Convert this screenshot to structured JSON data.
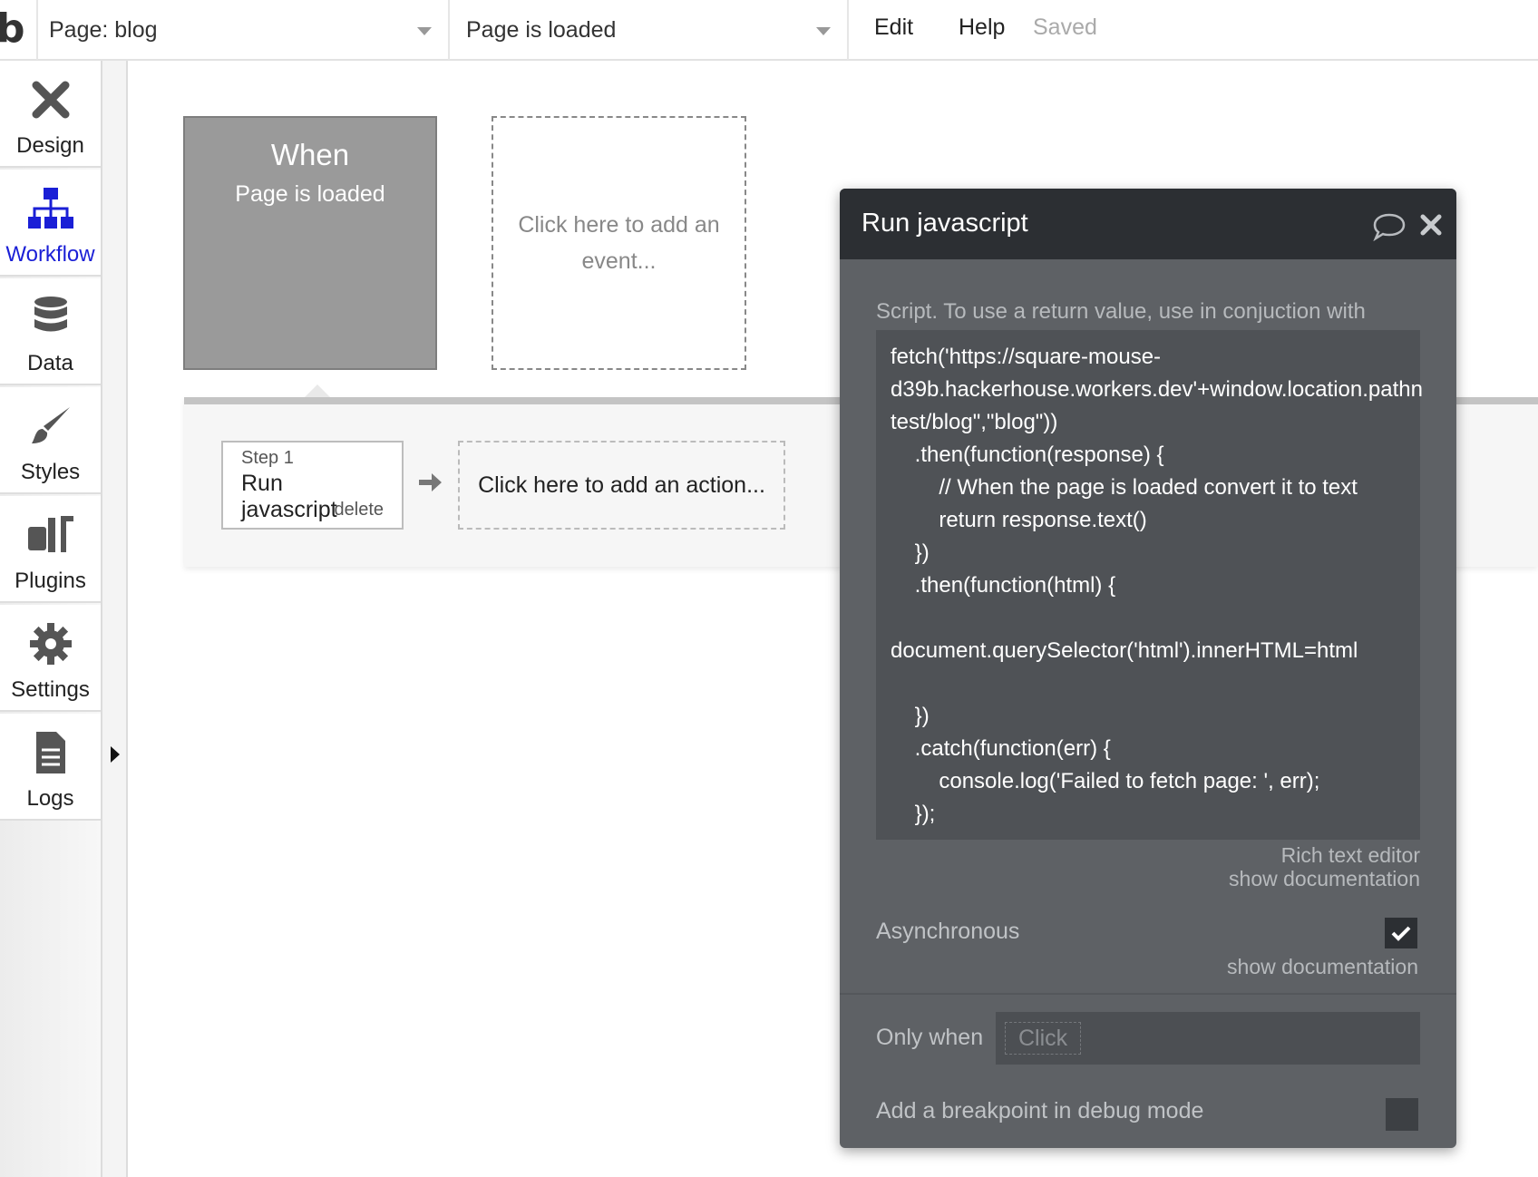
{
  "topbar": {
    "logo": "b",
    "page_select": "Page: blog",
    "event_select": "Page is loaded",
    "menu": [
      "Edit",
      "Help"
    ],
    "status": "Saved"
  },
  "sidebar": {
    "items": [
      {
        "label": "Design",
        "icon": "design-icon"
      },
      {
        "label": "Workflow",
        "icon": "workflow-icon",
        "active": true
      },
      {
        "label": "Data",
        "icon": "database-icon"
      },
      {
        "label": "Styles",
        "icon": "brush-icon"
      },
      {
        "label": "Plugins",
        "icon": "plugins-icon"
      },
      {
        "label": "Settings",
        "icon": "gear-icon"
      },
      {
        "label": "Logs",
        "icon": "document-icon"
      }
    ]
  },
  "canvas": {
    "event_card": {
      "title": "When",
      "subtitle": "Page is loaded"
    },
    "add_event": "Click here to add an event...",
    "step": {
      "number": "Step 1",
      "name": "Run javascript",
      "delete": "delete"
    },
    "add_action": "Click here to add an action..."
  },
  "panel": {
    "title": "Run javascript",
    "script_label": "Script. To use a return value, use in conjuction with",
    "code": "fetch('https://square-mouse-\nd39b.hackerhouse.workers.dev'+window.location.pathn\ntest/blog\",\"blog\"))\n    .then(function(response) {\n        // When the page is loaded convert it to text\n        return response.text()\n    })\n    .then(function(html) {\n\ndocument.querySelector('html').innerHTML=html\n\n    })\n    .catch(function(err) {\n        console.log('Failed to fetch page: ', err);\n    });",
    "rich_text_editor": "Rich text editor",
    "show_documentation_1": "show documentation",
    "asynchronous_label": "Asynchronous",
    "asynchronous_checked": true,
    "show_documentation_2": "show documentation",
    "only_when_label": "Only when",
    "only_when_placeholder": "Click",
    "breakpoint_label": "Add a breakpoint in debug mode"
  },
  "colors": {
    "active_blue": "#1a1fd6",
    "panel_bg": "#5e6165",
    "panel_header": "#2c2f33",
    "event_card": "#9a9a9a"
  }
}
